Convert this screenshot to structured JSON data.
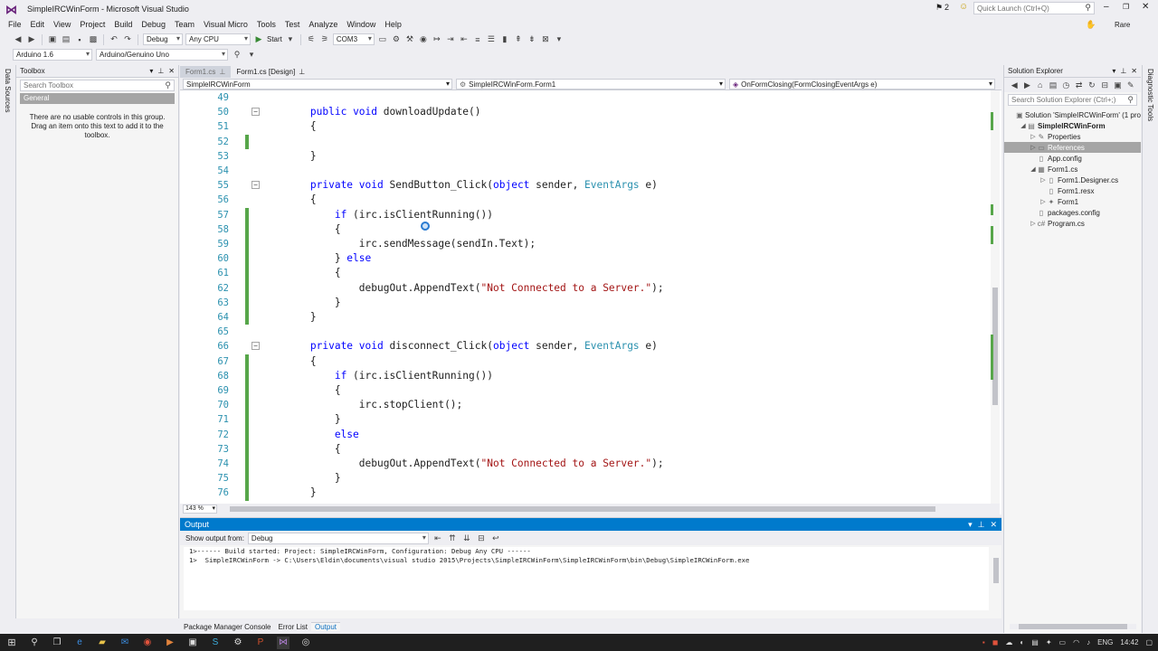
{
  "window": {
    "title": "SimpleIRCWinForm - Microsoft Visual Studio",
    "notifications": "2",
    "quick_launch_placeholder": "Quick Launch (Ctrl+Q)",
    "user": "Rare"
  },
  "menu": [
    "File",
    "Edit",
    "View",
    "Project",
    "Build",
    "Debug",
    "Team",
    "Visual Micro",
    "Tools",
    "Test",
    "Analyze",
    "Window",
    "Help"
  ],
  "toolbar": {
    "config": "Debug",
    "platform": "Any CPU",
    "start_label": "Start",
    "port": "COM3"
  },
  "toolbar2": {
    "ide_version": "Arduino 1.6",
    "board": "Arduino/Genuino Uno"
  },
  "left_strip": {
    "label": "Data Sources"
  },
  "toolbox": {
    "title": "Toolbox",
    "search_placeholder": "Search Toolbox",
    "group": "General",
    "message": "There are no usable controls in this group. Drag an item onto this text to add it to the toolbox."
  },
  "editor": {
    "tabs": [
      {
        "label": "Form1.cs",
        "active": false
      },
      {
        "label": "Form1.cs [Design]",
        "active": true
      }
    ],
    "nav": {
      "project": "SimpleIRCWinForm",
      "class": "SimpleIRCWinForm.Form1",
      "member": "OnFormClosing(FormClosingEventArgs e)"
    },
    "zoom": "143 %",
    "lines": [
      {
        "n": "49",
        "t": []
      },
      {
        "n": "50",
        "fold": true,
        "t": [
          [
            "        ",
            ""
          ],
          [
            "public",
            "kw"
          ],
          [
            " ",
            ""
          ],
          [
            "void",
            "kw"
          ],
          [
            " downloadUpdate()",
            ""
          ]
        ]
      },
      {
        "n": "51",
        "t": [
          [
            "        {",
            ""
          ]
        ]
      },
      {
        "n": "52",
        "chg": true,
        "t": []
      },
      {
        "n": "53",
        "t": [
          [
            "        }",
            ""
          ]
        ]
      },
      {
        "n": "54",
        "t": []
      },
      {
        "n": "55",
        "fold": true,
        "t": [
          [
            "        ",
            ""
          ],
          [
            "private",
            "kw"
          ],
          [
            " ",
            ""
          ],
          [
            "void",
            "kw"
          ],
          [
            " SendButton_Click(",
            ""
          ],
          [
            "object",
            "kw"
          ],
          [
            " sender, ",
            ""
          ],
          [
            "EventArgs",
            "ty"
          ],
          [
            " e)",
            ""
          ]
        ]
      },
      {
        "n": "56",
        "t": [
          [
            "        {",
            ""
          ]
        ]
      },
      {
        "n": "57",
        "chg": true,
        "t": [
          [
            "            ",
            ""
          ],
          [
            "if",
            "kw"
          ],
          [
            " (irc.isClientRunning())",
            ""
          ]
        ]
      },
      {
        "n": "58",
        "chg": true,
        "t": [
          [
            "            {",
            ""
          ]
        ]
      },
      {
        "n": "59",
        "chg": true,
        "t": [
          [
            "                irc.sendMessage(sendIn.Text);",
            ""
          ]
        ]
      },
      {
        "n": "60",
        "chg": true,
        "t": [
          [
            "            } ",
            ""
          ],
          [
            "else",
            "kw"
          ]
        ]
      },
      {
        "n": "61",
        "chg": true,
        "t": [
          [
            "            {",
            ""
          ]
        ]
      },
      {
        "n": "62",
        "chg": true,
        "t": [
          [
            "                debugOut.AppendText(",
            ""
          ],
          [
            "\"Not Connected to a Server.\"",
            "str"
          ],
          [
            ");",
            ""
          ]
        ]
      },
      {
        "n": "63",
        "chg": true,
        "t": [
          [
            "            }",
            ""
          ]
        ]
      },
      {
        "n": "64",
        "chg": true,
        "t": [
          [
            "        }",
            ""
          ]
        ]
      },
      {
        "n": "65",
        "t": []
      },
      {
        "n": "66",
        "fold": true,
        "t": [
          [
            "        ",
            ""
          ],
          [
            "private",
            "kw"
          ],
          [
            " ",
            ""
          ],
          [
            "void",
            "kw"
          ],
          [
            " disconnect_Click(",
            ""
          ],
          [
            "object",
            "kw"
          ],
          [
            " sender, ",
            ""
          ],
          [
            "EventArgs",
            "ty"
          ],
          [
            " e)",
            ""
          ]
        ]
      },
      {
        "n": "67",
        "chg": true,
        "t": [
          [
            "        {",
            ""
          ]
        ]
      },
      {
        "n": "68",
        "chg": true,
        "t": [
          [
            "            ",
            ""
          ],
          [
            "if",
            "kw"
          ],
          [
            " (irc.isClientRunning())",
            ""
          ]
        ]
      },
      {
        "n": "69",
        "chg": true,
        "t": [
          [
            "            {",
            ""
          ]
        ]
      },
      {
        "n": "70",
        "chg": true,
        "t": [
          [
            "                irc.stopClient();",
            ""
          ]
        ]
      },
      {
        "n": "71",
        "chg": true,
        "t": [
          [
            "            }",
            ""
          ]
        ]
      },
      {
        "n": "72",
        "chg": true,
        "t": [
          [
            "            ",
            ""
          ],
          [
            "else",
            "kw"
          ]
        ]
      },
      {
        "n": "73",
        "chg": true,
        "t": [
          [
            "            {",
            ""
          ]
        ]
      },
      {
        "n": "74",
        "chg": true,
        "t": [
          [
            "                debugOut.AppendText(",
            ""
          ],
          [
            "\"Not Connected to a Server.\"",
            "str"
          ],
          [
            ");",
            ""
          ]
        ]
      },
      {
        "n": "75",
        "chg": true,
        "t": [
          [
            "            }",
            ""
          ]
        ]
      },
      {
        "n": "76",
        "chg": true,
        "t": [
          [
            "        }",
            ""
          ]
        ]
      }
    ]
  },
  "output": {
    "title": "Output",
    "show_from_label": "Show output from:",
    "source": "Debug",
    "lines": [
      "1>------ Build started: Project: SimpleIRCWinForm, Configuration: Debug Any CPU ------",
      "1>  SimpleIRCWinForm -> C:\\Users\\Eldin\\documents\\visual studio 2015\\Projects\\SimpleIRCWinForm\\SimpleIRCWinForm\\bin\\Debug\\SimpleIRCWinForm.exe"
    ]
  },
  "bottom_tabs": [
    "Package Manager Console",
    "Error List",
    "Output"
  ],
  "solution": {
    "title": "Solution Explorer",
    "search_placeholder": "Search Solution Explorer (Ctrl+;)",
    "nodes": [
      {
        "label": "Solution 'SimpleIRCWinForm' (1 pro",
        "depth": 0,
        "exp": "",
        "icon": "▣"
      },
      {
        "label": "SimpleIRCWinForm",
        "depth": 1,
        "exp": "◢",
        "icon": "▤",
        "bold": true
      },
      {
        "label": "Properties",
        "depth": 2,
        "exp": "▷",
        "icon": "✎"
      },
      {
        "label": "References",
        "depth": 2,
        "exp": "▷",
        "icon": "▭",
        "sel": true
      },
      {
        "label": "App.config",
        "depth": 2,
        "exp": "",
        "icon": "▯"
      },
      {
        "label": "Form1.cs",
        "depth": 2,
        "exp": "◢",
        "icon": "▦"
      },
      {
        "label": "Form1.Designer.cs",
        "depth": 3,
        "exp": "▷",
        "icon": "▯"
      },
      {
        "label": "Form1.resx",
        "depth": 3,
        "exp": "",
        "icon": "▯"
      },
      {
        "label": "Form1",
        "depth": 3,
        "exp": "▷",
        "icon": "✦"
      },
      {
        "label": "packages.config",
        "depth": 2,
        "exp": "",
        "icon": "▯"
      },
      {
        "label": "Program.cs",
        "depth": 2,
        "exp": "▷",
        "icon": "c#"
      }
    ]
  },
  "right_strip": {
    "label": "Diagnostic Tools"
  },
  "taskbar": {
    "lang": "ENG",
    "time": "14:42"
  },
  "colors": {
    "accent": "#007acc",
    "keyword": "#0000ff",
    "type": "#2b91af",
    "string": "#a31515",
    "change_bar": "#57a64a"
  }
}
